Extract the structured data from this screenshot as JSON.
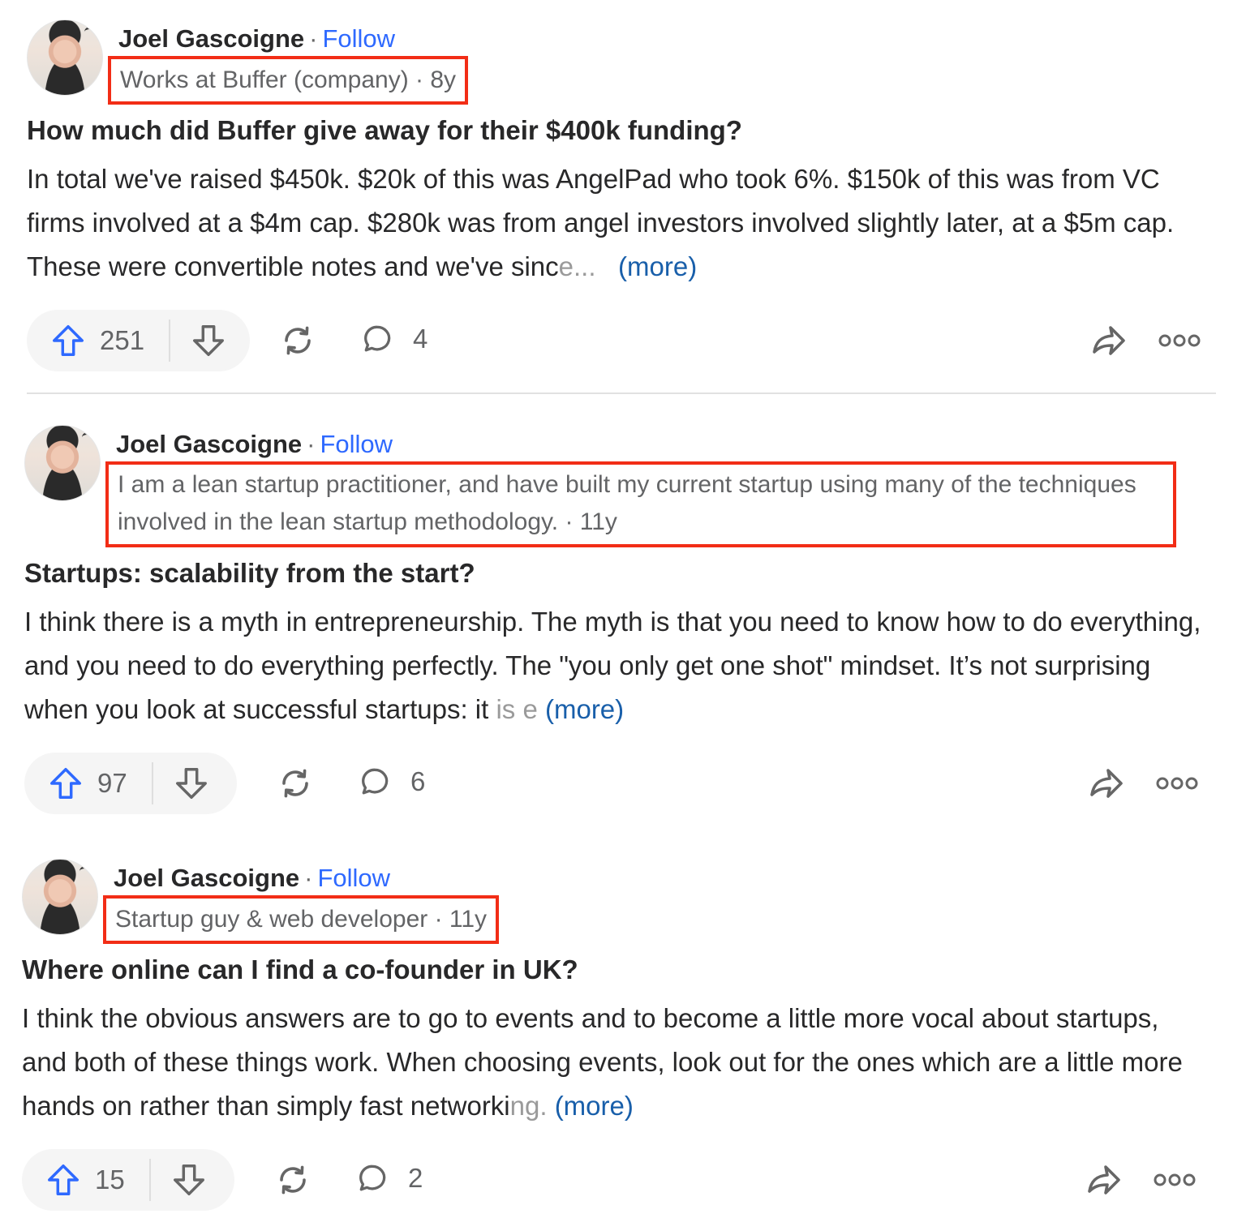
{
  "colors": {
    "accent_blue": "#2e69ff",
    "more_link": "#195faa",
    "highlight_box": "#f22d16",
    "text_primary": "#282829",
    "text_secondary": "#636466",
    "pill_bg": "#f5f5f5"
  },
  "posts": [
    {
      "author": "Joel Gascoigne",
      "separator": "·",
      "follow_label": "Follow",
      "credential": "Works at Buffer (company) · 8y",
      "title": "How much did Buffer give away for their $400k funding?",
      "body_text": "In total we've raised $450k. $20k of this was AngelPad who took 6%. $150k of this was from VC firms involved at a $4m cap. $280k was from angel investors involved slightly later, at a $5m cap. These were convertible notes and we've sinc",
      "body_fade": "e...",
      "more_label": "(more)",
      "upvotes": "251",
      "comments": "4",
      "icons": [
        "upvote-icon",
        "downvote-icon",
        "reshare-icon",
        "comment-icon",
        "share-icon",
        "more-options-icon"
      ]
    },
    {
      "author": "Joel Gascoigne",
      "separator": "·",
      "follow_label": "Follow",
      "credential": "I am a lean startup practitioner, and have built my current startup using many of the techniques involved in the lean startup methodology. · 11y",
      "title": "Startups: scalability from the start?",
      "body_text": "I think there is a myth in entrepreneurship. The myth is that you need to know how to do everything, and you need to do everything perfectly. The \"you only get one shot\" mindset. It’s not surprising when you look at successful startups: it ",
      "body_fade": "is e",
      "more_label": "(more)",
      "upvotes": "97",
      "comments": "6",
      "icons": [
        "upvote-icon",
        "downvote-icon",
        "reshare-icon",
        "comment-icon",
        "share-icon",
        "more-options-icon"
      ]
    },
    {
      "author": "Joel Gascoigne",
      "separator": "·",
      "follow_label": "Follow",
      "credential": "Startup guy & web developer · 11y",
      "title": "Where online can I find a co-founder in UK?",
      "body_text": "I think the obvious answers are to go to events and to become a little more vocal about startups, and both of these things work. When choosing events, look out for the ones which are a little more hands on rather than simply fast networki",
      "body_fade": "ng.",
      "more_label": "(more)",
      "upvotes": "15",
      "comments": "2",
      "icons": [
        "upvote-icon",
        "downvote-icon",
        "reshare-icon",
        "comment-icon",
        "share-icon",
        "more-options-icon"
      ]
    }
  ]
}
